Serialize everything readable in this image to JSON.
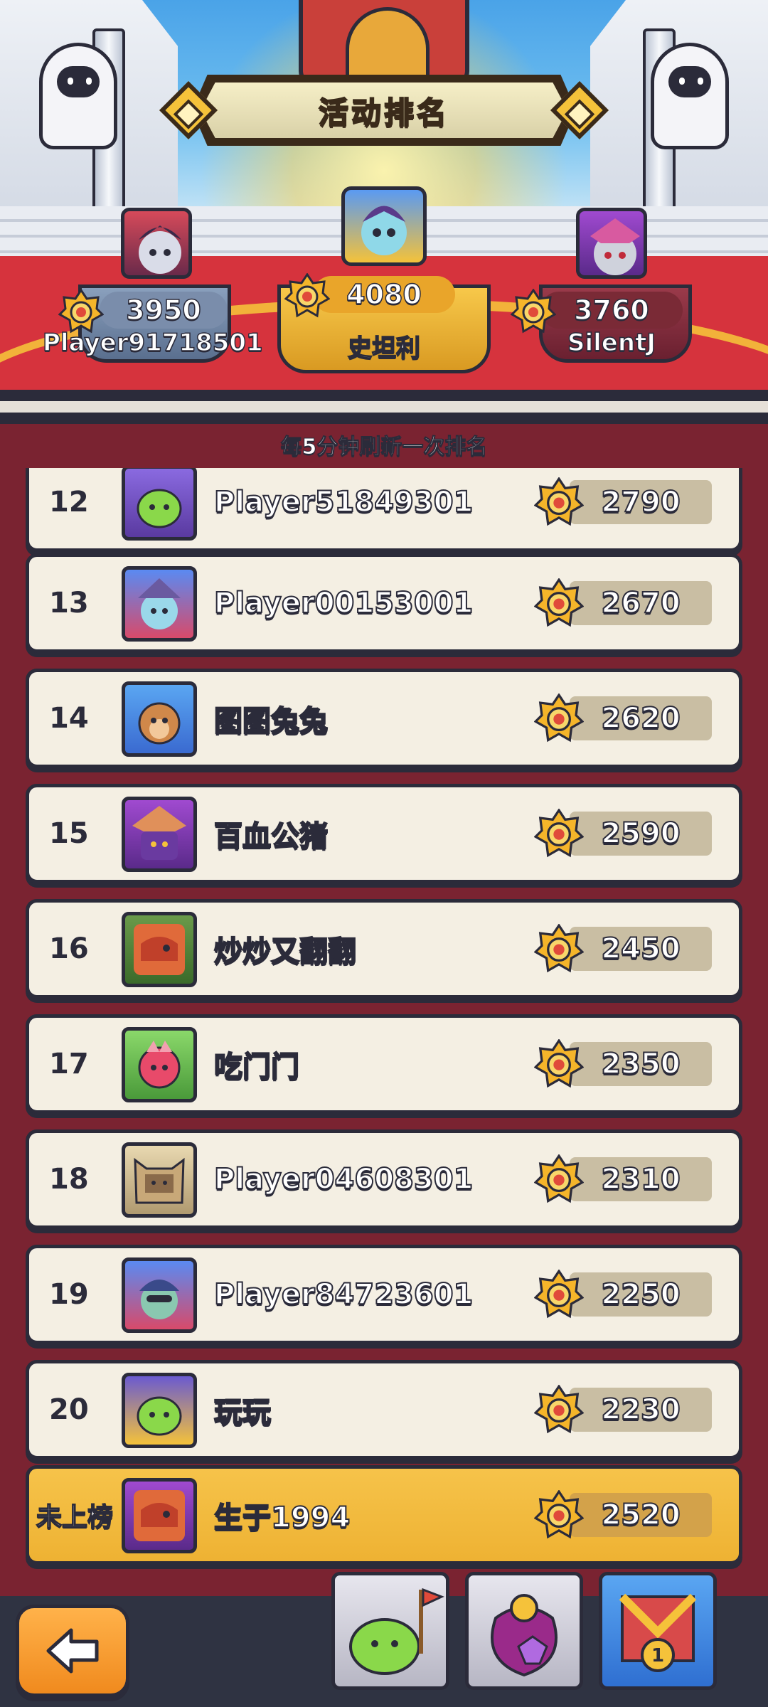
{
  "header": {
    "title": "活动排名"
  },
  "podium": [
    {
      "place": 2,
      "score": "3950",
      "name": "Player91718501"
    },
    {
      "place": 1,
      "score": "4080",
      "name": "史坦利"
    },
    {
      "place": 3,
      "score": "3760",
      "name": "SilentJ"
    }
  ],
  "refresh_note": "每5分钟刷新一次排名",
  "ranking": [
    {
      "rank": "12",
      "name": "Player51849301",
      "score": "2790"
    },
    {
      "rank": "13",
      "name": "Player00153001",
      "score": "2670"
    },
    {
      "rank": "14",
      "name": "图图兔兔",
      "score": "2620"
    },
    {
      "rank": "15",
      "name": "百血公猪",
      "score": "2590"
    },
    {
      "rank": "16",
      "name": "炒炒又翻翻",
      "score": "2450"
    },
    {
      "rank": "17",
      "name": "吃门门",
      "score": "2350"
    },
    {
      "rank": "18",
      "name": "Player04608301",
      "score": "2310"
    },
    {
      "rank": "19",
      "name": "Player84723601",
      "score": "2250"
    },
    {
      "rank": "20",
      "name": "玩玩",
      "score": "2230"
    }
  ],
  "my_entry": {
    "rank": "未上榜",
    "name": "生于1994",
    "score": "2520"
  },
  "nav": {
    "active_tab": "ranking",
    "badge": "1"
  },
  "colors": {
    "outline": "#2b2b3a",
    "row_bg": "#f4efe3",
    "highlight_row": "#f2ba3c",
    "score_box": "#c9bea3",
    "background": "#7a2331",
    "accent_gold": "#f5c23a"
  }
}
